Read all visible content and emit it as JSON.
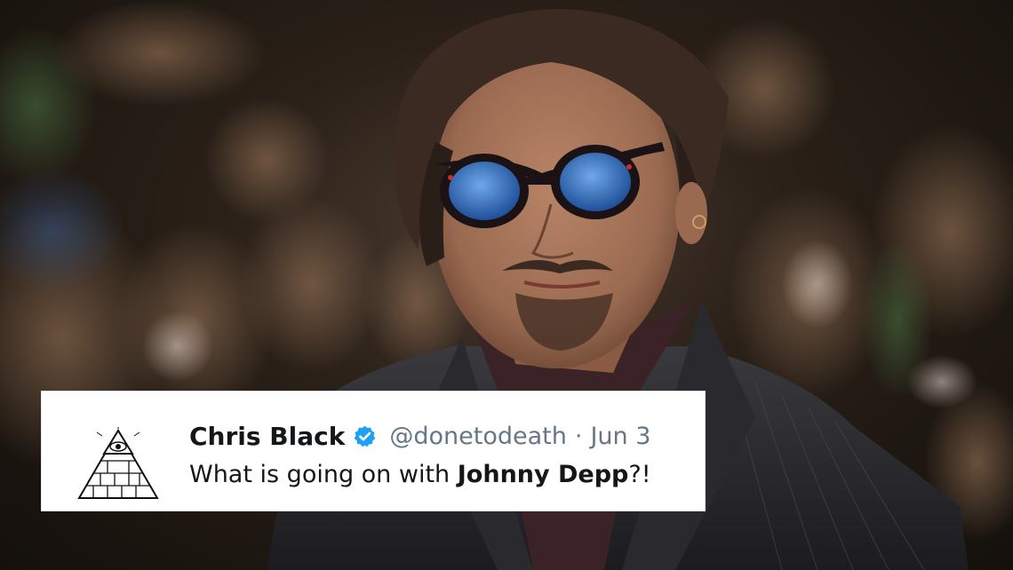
{
  "photo": {
    "subject": "man-in-blue-tinted-sunglasses"
  },
  "tweet": {
    "display_name": "Chris Black",
    "verified_icon": "verified-badge-icon",
    "handle": "@donetodeath",
    "separator": "·",
    "date": "Jun 3",
    "text_before": "What is going on with ",
    "text_bold": "Johnny Depp",
    "text_after": "?!",
    "avatar_icon": "pyramid-eye-icon"
  },
  "colors": {
    "verified_blue": "#1da1f2",
    "name_text": "#14171a",
    "meta_text": "#657786",
    "card_bg": "#ffffff"
  }
}
